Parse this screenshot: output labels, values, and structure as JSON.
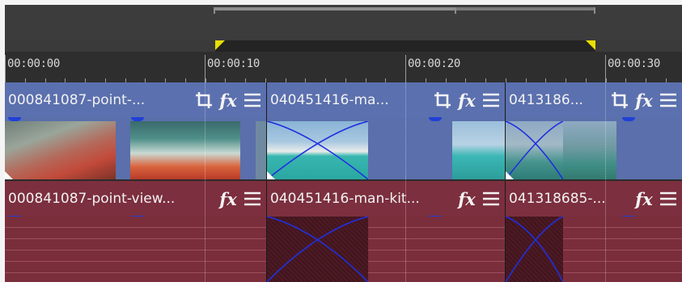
{
  "ruler": {
    "labels": [
      "00:00:00",
      "00:00:10",
      "00:00:20",
      "00:00:30"
    ]
  },
  "video_track": {
    "clips": [
      {
        "name": "000841087-point-..."
      },
      {
        "name": "040451416-ma..."
      },
      {
        "name": "0413186..."
      }
    ],
    "icons": [
      "crop-icon",
      "fx-icon",
      "menu-icon"
    ]
  },
  "audio_track": {
    "clips": [
      {
        "name": "000841087-point-view..."
      },
      {
        "name": "040451416-man-kit..."
      },
      {
        "name": "041318685-..."
      }
    ],
    "icons": [
      "fx-icon",
      "menu-icon"
    ]
  },
  "fx_label": "fx",
  "colors": {
    "video_clip": "#5b70ae",
    "audio_clip": "#7c2f3e",
    "loop_marker": "#e8e000",
    "crossfade_curve": "#2030e0"
  }
}
